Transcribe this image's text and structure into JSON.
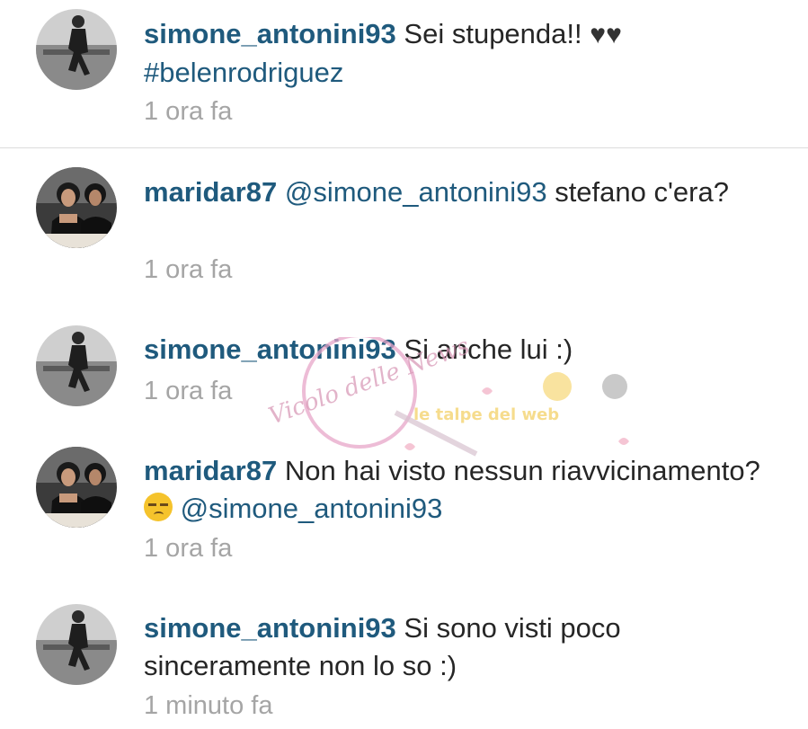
{
  "comments": [
    {
      "username": "simone_antonini93",
      "text": "Sei stupenda!!",
      "emoji": "♥♥",
      "hashtag": "#belenrodriguez",
      "time": "1 ora fa"
    },
    {
      "username": "maridar87",
      "mention": "@simone_antonini93",
      "text": "stefano c'era?",
      "time": "1 ora fa"
    },
    {
      "username": "simone_antonini93",
      "text": "Si anche lui :)",
      "time": "1 ora fa"
    },
    {
      "username": "maridar87",
      "text": "Non hai visto nessun riavvicinamento?",
      "mention": "@simone_antonini93",
      "time": "1 ora fa"
    },
    {
      "username": "simone_antonini93",
      "text": "Si sono visti poco sinceramente non lo so :)",
      "time": "1 minuto fa"
    }
  ],
  "watermark": {
    "left": "Vicolo delle News",
    "right": "le talpe del web"
  },
  "colors": {
    "username": "#1f5a7d",
    "text": "#262626",
    "time": "#a5a5a5",
    "divider": "#dcdcdc"
  }
}
